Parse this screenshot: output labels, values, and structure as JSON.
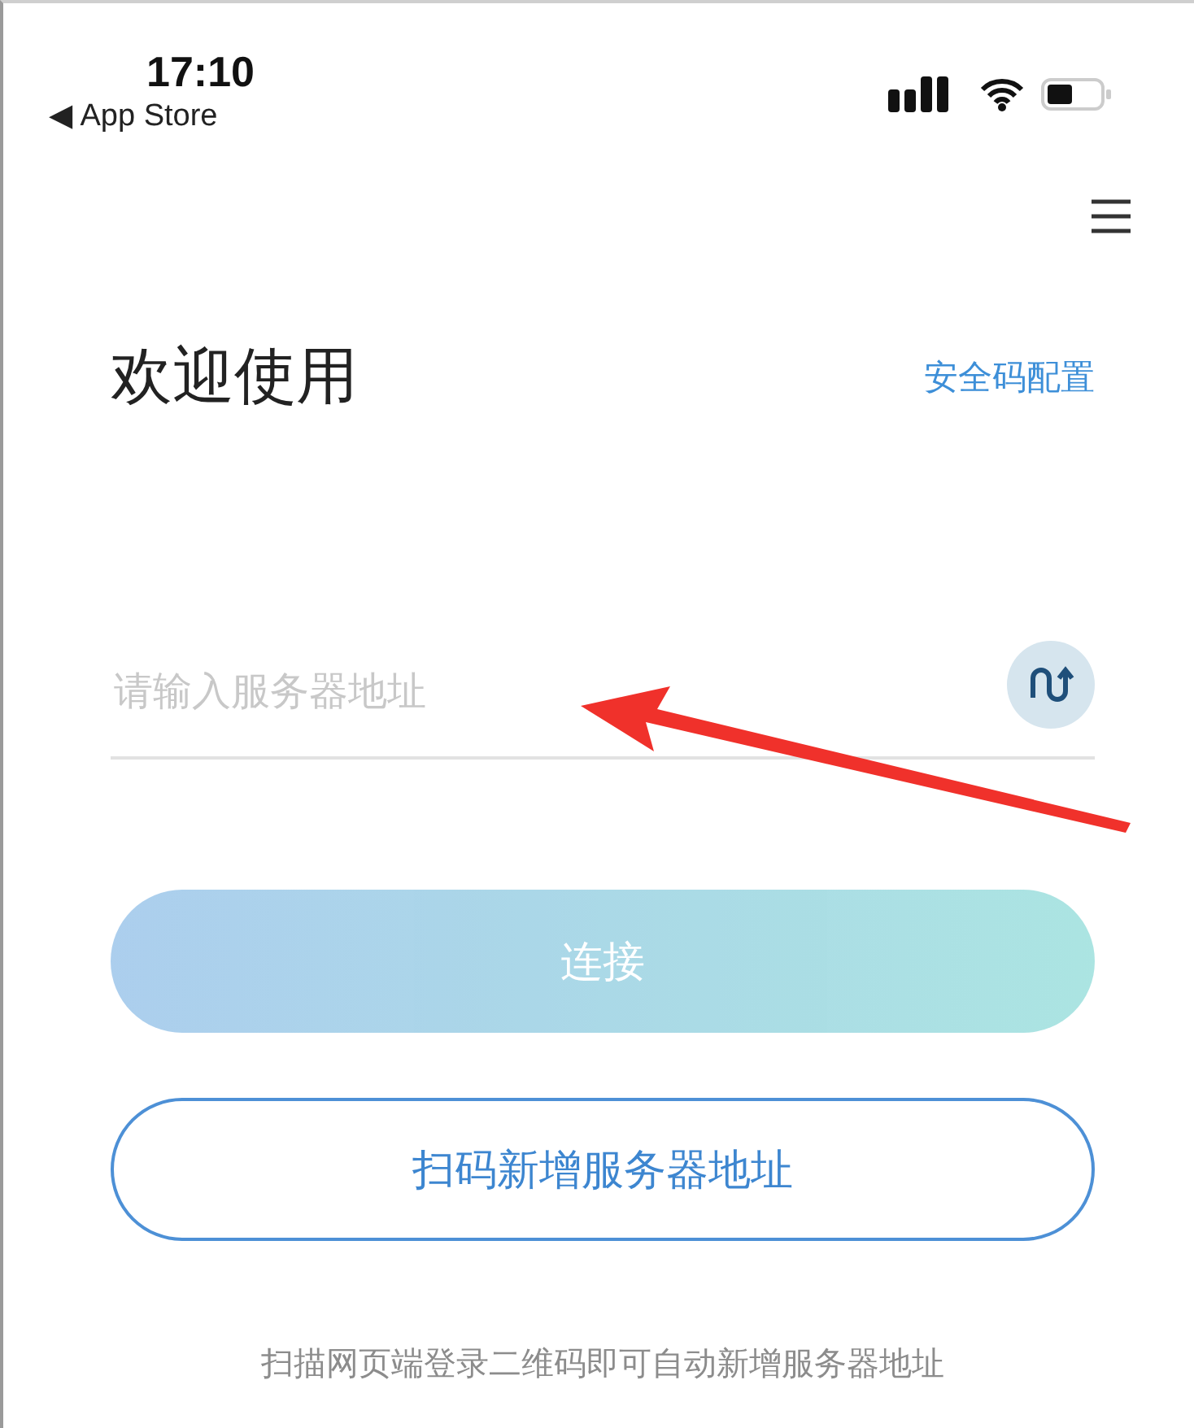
{
  "status_bar": {
    "time": "17:10",
    "back_label": "◀ App Store"
  },
  "title": "欢迎使用",
  "security_link": "安全码配置",
  "server_field": {
    "placeholder": "请输入服务器地址"
  },
  "connect_button": {
    "label": "连接",
    "disabled": true
  },
  "scan_button": {
    "label": "扫码新增服务器地址"
  },
  "hint": "扫描网页端登录二维码即可自动新增服务器地址"
}
